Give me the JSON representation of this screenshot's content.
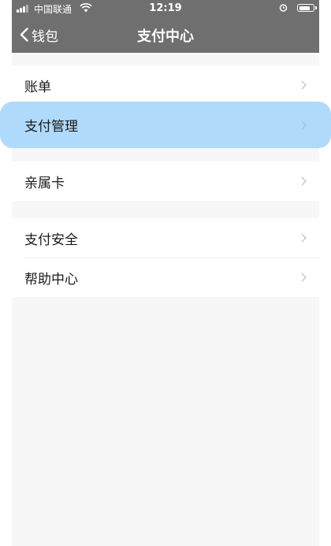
{
  "status_bar": {
    "carrier": "中国联通",
    "time": "12:19",
    "battery_level": 0.85
  },
  "nav": {
    "back_label": "钱包",
    "title": "支付中心"
  },
  "groups": [
    {
      "items": [
        {
          "label": "账单"
        },
        {
          "label": "支付管理"
        }
      ]
    },
    {
      "items": [
        {
          "label": "亲属卡"
        }
      ]
    },
    {
      "items": [
        {
          "label": "支付安全"
        },
        {
          "label": "帮助中心"
        }
      ]
    }
  ],
  "colors": {
    "nav_bg": "#6f6f6f",
    "page_bg": "#f7f7f7",
    "highlight": "#b0dafb",
    "chevron": "#c8c8c8"
  }
}
